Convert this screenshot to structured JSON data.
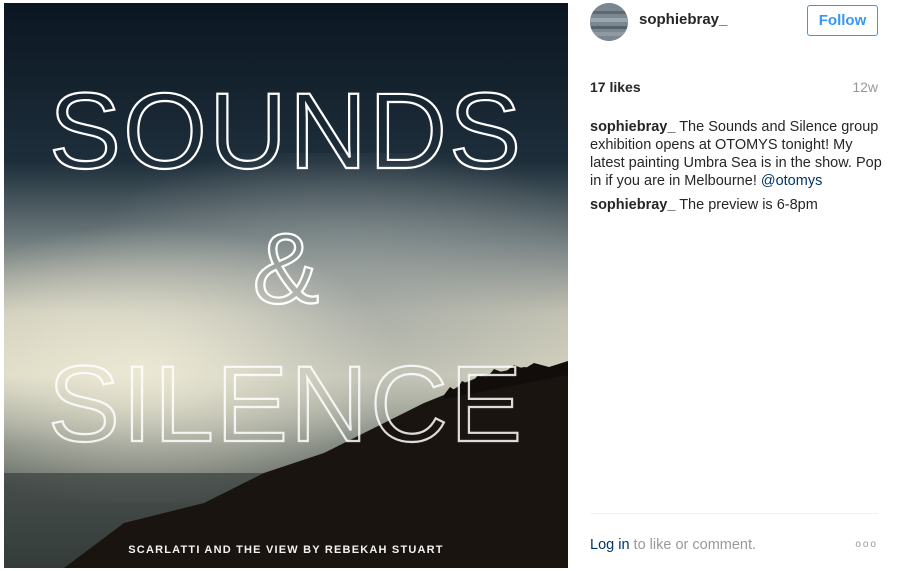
{
  "media": {
    "title_line1": "SOUNDS",
    "ampersand": "&",
    "title_line2": "SILENCE",
    "caption": "SCARLATTI AND THE VIEW BY REBEKAH STUART"
  },
  "header": {
    "username": "sophiebray_",
    "follow_label": "Follow"
  },
  "stats": {
    "likes": "17 likes",
    "age": "12w"
  },
  "comments": [
    {
      "user": "sophiebray_",
      "text": "The Sounds and Silence group exhibition opens at OTOMYS tonight! My latest painting Umbra Sea is in the show. Pop in if you are in Melbourne!",
      "mention": "@otomys"
    },
    {
      "user": "sophiebray_",
      "text": "The preview is 6-8pm"
    }
  ],
  "footer": {
    "login_label": "Log in",
    "login_rest": "to like or comment.",
    "more": "ooo"
  },
  "icons": [
    "avatar-icon",
    "more-options-icon"
  ]
}
